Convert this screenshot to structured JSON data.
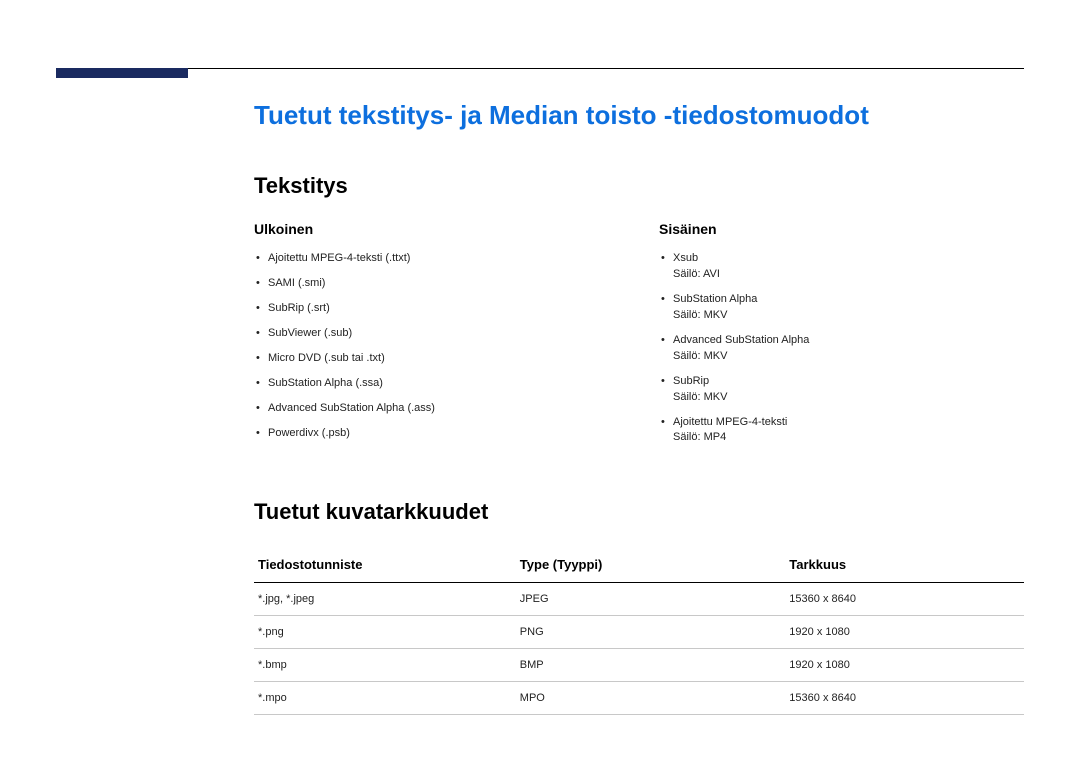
{
  "pageTitle": "Tuetut tekstitys- ja Median toisto -tiedostomuodot",
  "section1": {
    "title": "Tekstitys",
    "external": {
      "header": "Ulkoinen",
      "items": [
        "Ajoitettu MPEG-4-teksti (.ttxt)",
        "SAMI (.smi)",
        "SubRip (.srt)",
        "SubViewer (.sub)",
        "Micro DVD (.sub tai .txt)",
        "SubStation Alpha (.ssa)",
        "Advanced SubStation Alpha (.ass)",
        "Powerdivx (.psb)"
      ]
    },
    "internal": {
      "header": "Sisäinen",
      "items": [
        {
          "name": "Xsub",
          "container": "Säilö: AVI"
        },
        {
          "name": "SubStation Alpha",
          "container": "Säilö: MKV"
        },
        {
          "name": "Advanced SubStation Alpha",
          "container": "Säilö: MKV"
        },
        {
          "name": "SubRip",
          "container": "Säilö: MKV"
        },
        {
          "name": "Ajoitettu MPEG-4-teksti",
          "container": "Säilö: MP4"
        }
      ]
    }
  },
  "section2": {
    "title": "Tuetut kuvatarkkuudet",
    "headers": {
      "ext": "Tiedostotunniste",
      "type": "Type (Tyyppi)",
      "res": "Tarkkuus"
    },
    "rows": [
      {
        "ext": "*.jpg, *.jpeg",
        "type": "JPEG",
        "res": "15360 x 8640"
      },
      {
        "ext": "*.png",
        "type": "PNG",
        "res": "1920 x 1080"
      },
      {
        "ext": "*.bmp",
        "type": "BMP",
        "res": "1920 x 1080"
      },
      {
        "ext": "*.mpo",
        "type": "MPO",
        "res": "15360 x 8640"
      }
    ]
  }
}
